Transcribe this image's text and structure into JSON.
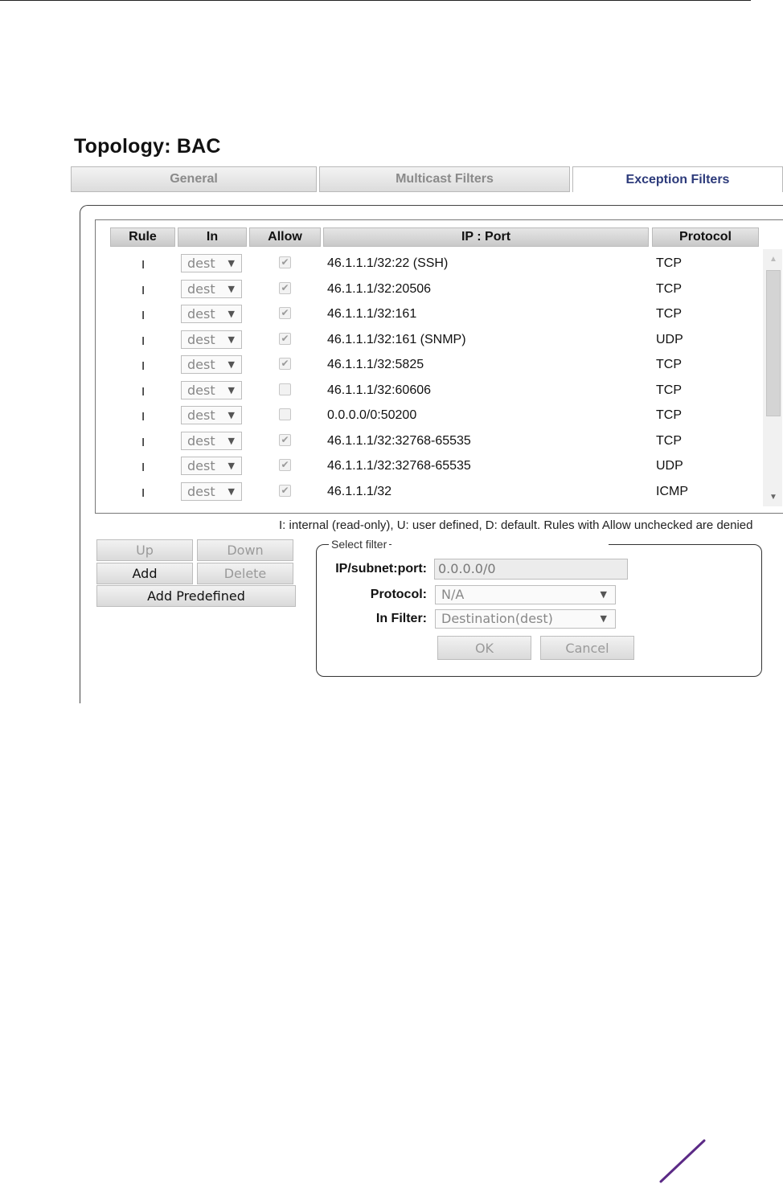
{
  "page": {
    "title": "Topology: BAC"
  },
  "tabs": [
    {
      "label": "General",
      "active": false
    },
    {
      "label": "Multicast Filters",
      "active": false
    },
    {
      "label": "Exception Filters",
      "active": true
    }
  ],
  "grid": {
    "columns": [
      "Rule",
      "In",
      "Allow",
      "IP : Port",
      "Protocol"
    ],
    "rows": [
      {
        "rule": "I",
        "in": "dest",
        "allow": true,
        "ip_port": "46.1.1.1/32:22 (SSH)",
        "protocol": "TCP"
      },
      {
        "rule": "I",
        "in": "dest",
        "allow": true,
        "ip_port": "46.1.1.1/32:20506",
        "protocol": "TCP"
      },
      {
        "rule": "I",
        "in": "dest",
        "allow": true,
        "ip_port": "46.1.1.1/32:161",
        "protocol": "TCP"
      },
      {
        "rule": "I",
        "in": "dest",
        "allow": true,
        "ip_port": "46.1.1.1/32:161 (SNMP)",
        "protocol": "UDP"
      },
      {
        "rule": "I",
        "in": "dest",
        "allow": true,
        "ip_port": "46.1.1.1/32:5825",
        "protocol": "TCP"
      },
      {
        "rule": "I",
        "in": "dest",
        "allow": false,
        "ip_port": "46.1.1.1/32:60606",
        "protocol": "TCP"
      },
      {
        "rule": "I",
        "in": "dest",
        "allow": false,
        "ip_port": "0.0.0.0/0:50200",
        "protocol": "TCP"
      },
      {
        "rule": "I",
        "in": "dest",
        "allow": true,
        "ip_port": "46.1.1.1/32:32768-65535",
        "protocol": "TCP"
      },
      {
        "rule": "I",
        "in": "dest",
        "allow": true,
        "ip_port": "46.1.1.1/32:32768-65535",
        "protocol": "UDP"
      },
      {
        "rule": "I",
        "in": "dest",
        "allow": true,
        "ip_port": "46.1.1.1/32",
        "protocol": "ICMP"
      }
    ],
    "legend": "I: internal (read-only), U: user defined, D: default. Rules with Allow unchecked are denied"
  },
  "buttons": {
    "up": "Up",
    "down": "Down",
    "add": "Add",
    "delete": "Delete",
    "add_predefined": "Add Predefined"
  },
  "select_filter": {
    "legend": "Select filter",
    "ip_label": "IP/subnet:port:",
    "ip_value": "0.0.0.0/0",
    "protocol_label": "Protocol:",
    "protocol_value": "N/A",
    "in_filter_label": "In Filter:",
    "in_filter_value": "Destination(dest)",
    "ok": "OK",
    "cancel": "Cancel"
  },
  "icons": {
    "dropdown": "chevron-down-icon",
    "checkbox": "check-icon",
    "brand": "brand-slash-icon"
  },
  "colors": {
    "active_tab_text": "#2c3a7a",
    "brand": "#5b2a86"
  }
}
